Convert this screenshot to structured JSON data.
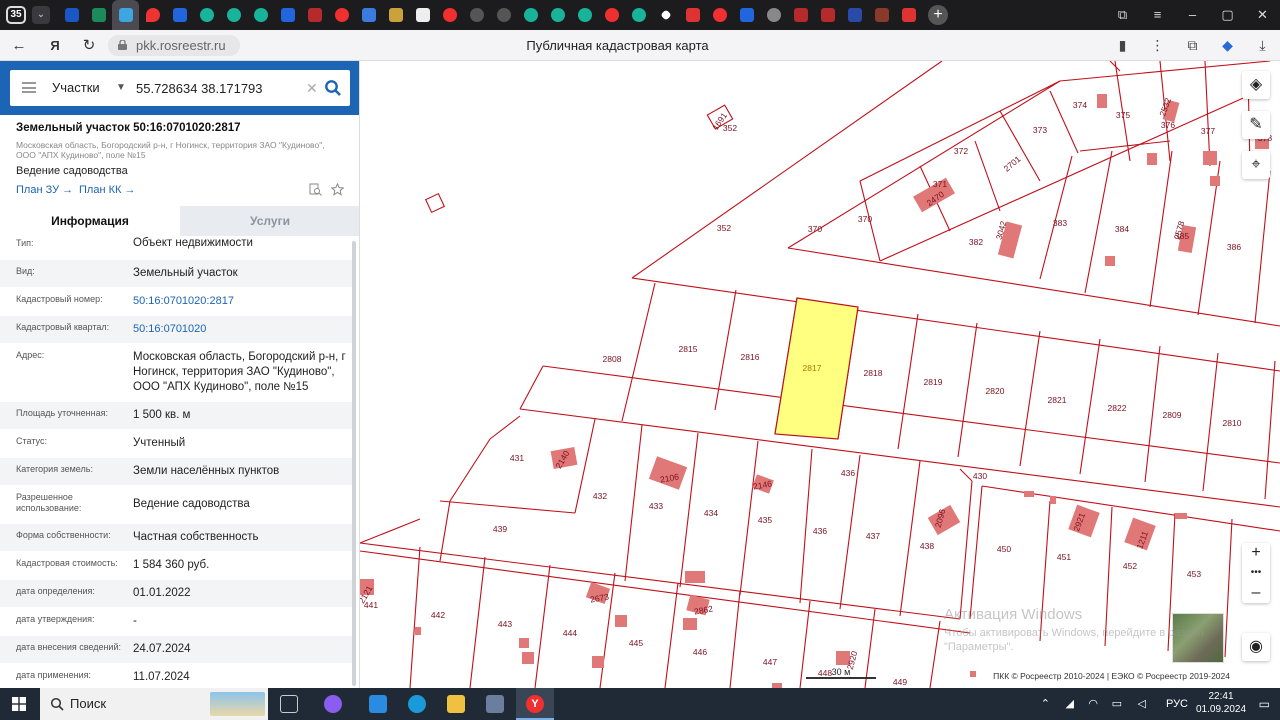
{
  "browser": {
    "tab_count": "35",
    "url": "pkk.rosreestr.ru",
    "page_title": "Публичная кадастровая карта"
  },
  "search": {
    "type": "Участки",
    "value": "55.728634 38.171793"
  },
  "parcel": {
    "title": "Земельный участок 50:16:0701020:2817",
    "address": "Московская область, Богородский р-н, г Ногинск, территория ЗАО \"Кудиново\", ООО \"АПХ Кудиново\", поле №15",
    "usage": "Ведение садоводства",
    "link_plan_zu": "План ЗУ →",
    "link_plan_kk": "План КК →"
  },
  "tabs": {
    "info": "Информация",
    "services": "Услуги"
  },
  "rows": [
    {
      "label": "Тип:",
      "value": "Объект недвижимости"
    },
    {
      "label": "Вид:",
      "value": "Земельный участок"
    },
    {
      "label": "Кадастровый номер:",
      "value": "50:16:0701020:2817"
    },
    {
      "label": "Кадастровый квартал:",
      "value": "50:16:0701020"
    },
    {
      "label": "Адрес:",
      "value": "Московская область, Богородский р-н, г Ногинск, территория ЗАО \"Кудиново\", ООО \"АПХ Кудиново\", поле №15"
    },
    {
      "label": "Площадь уточненная:",
      "value": "1 500 кв. м"
    },
    {
      "label": "Статус:",
      "value": "Учтенный"
    },
    {
      "label": "Категория земель:",
      "value": "Земли населённых пунктов"
    },
    {
      "label": "Разрешенное использование:",
      "value": "Ведение садоводства"
    },
    {
      "label": "Форма собственности:",
      "value": "Частная собственность"
    },
    {
      "label": "Кадастровая стоимость:",
      "value": "1 584 360 руб."
    },
    {
      "label": "дата определения:",
      "value": "01.01.2022"
    },
    {
      "label": "дата утверждения:",
      "value": "-"
    },
    {
      "label": "дата внесения сведений:",
      "value": "24.07.2024"
    },
    {
      "label": "дата применения:",
      "value": "11.07.2024"
    }
  ],
  "map": {
    "parcel_labels": [
      "352",
      "352",
      "370",
      "370",
      "371",
      "372",
      "373",
      "374",
      "375",
      "376",
      "377",
      "378",
      "382",
      "383",
      "384",
      "385",
      "386",
      "1691",
      "2470",
      "2701",
      "3042",
      "2532",
      "2578",
      "2808",
      "2815",
      "2816",
      "2817",
      "2818",
      "2819",
      "2820",
      "2821",
      "2822",
      "2809",
      "2810",
      "430",
      "431",
      "432",
      "433",
      "434",
      "435",
      "436",
      "436",
      "437",
      "438",
      "439",
      "441",
      "442",
      "443",
      "444",
      "445",
      "446",
      "447",
      "448",
      "449",
      "450",
      "451",
      "452",
      "453",
      "2140",
      "2106",
      "2146",
      "2096",
      "2673",
      "2862",
      "2920",
      "2121",
      "1211",
      "2921"
    ],
    "scale_label": "30 м",
    "credits": "ПКК © Росреестр 2010-2024 | ЕЭКО © Росреестр 2019-2024",
    "watermark_title": "Активация Windows",
    "watermark_text": "Чтобы активировать Windows, перейдите в раздел \"Параметры\".",
    "highlight_color": "#ffff80",
    "boundary_color": "#c0101a",
    "building_color": "#e07878"
  },
  "taskbar": {
    "search_label": "Поиск",
    "lang": "РУС",
    "time": "22:41",
    "date": "01.09.2024"
  }
}
